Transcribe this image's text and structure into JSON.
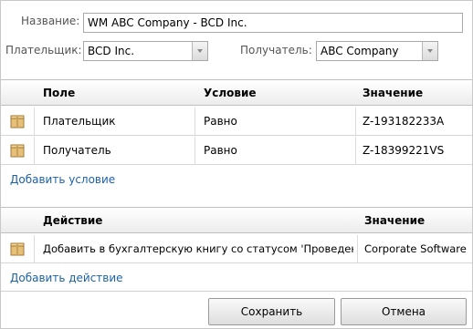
{
  "form": {
    "name_label": "Название:",
    "name_value": "WM ABC Company - BCD Inc.",
    "payer_label": "Плательщик:",
    "payer_value": "BCD Inc.",
    "recipient_label": "Получатель:",
    "recipient_value": "ABC Company"
  },
  "conditions": {
    "columns": {
      "field": "Поле",
      "condition": "Условие",
      "value": "Значение"
    },
    "rows": [
      {
        "field": "Плательщик",
        "condition": "Равно",
        "value": "Z-193182233A",
        "icon": "box-icon"
      },
      {
        "field": "Получатель",
        "condition": "Равно",
        "value": "Z-18399221VS",
        "icon": "box-icon"
      }
    ],
    "add_link": "Добавить условие"
  },
  "actions": {
    "columns": {
      "action": "Действие",
      "value": "Значение"
    },
    "rows": [
      {
        "action": "Добавить в бухгалтерскую книгу со статусом 'Проведено'",
        "value": "Corporate Software",
        "icon": "box-icon"
      }
    ],
    "add_link": "Добавить действие"
  },
  "buttons": {
    "save": "Сохранить",
    "cancel": "Отмена"
  }
}
